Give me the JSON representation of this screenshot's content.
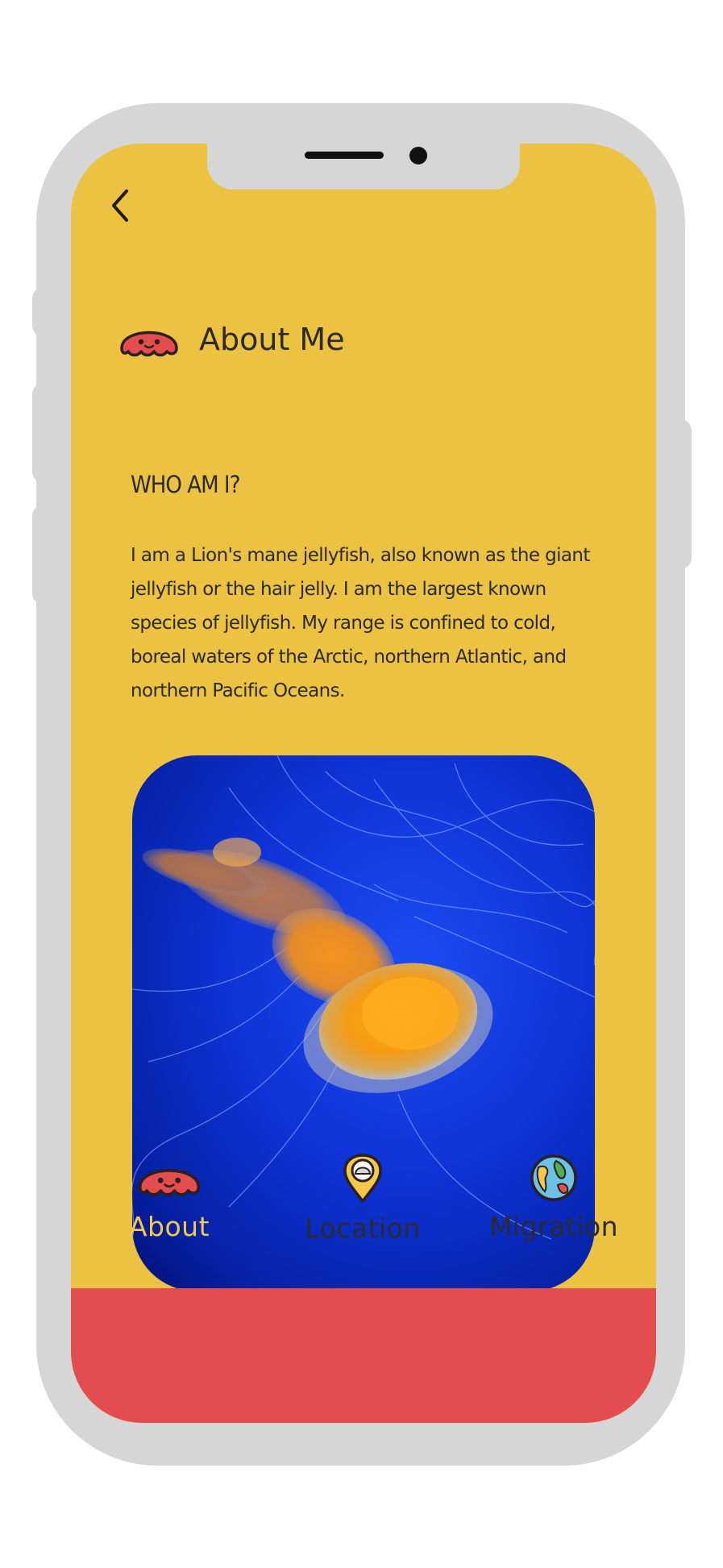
{
  "colors": {
    "screen_bg": "#ecc243",
    "tabbar_bg": "#e44d4d",
    "active_tab": "#f2c94c",
    "inactive_tab": "#2d2a2e",
    "frame": "#d6d6d6"
  },
  "header": {
    "back_icon": "chevron-left-icon",
    "logo_icon": "jellyfish-icon",
    "title": "About Me"
  },
  "content": {
    "heading": "WHO AM I?",
    "body": "I am a Lion's mane jellyfish, also known as the giant jellyfish or the hair jelly. I am the largest known species of jellyfish. My range is confined to cold, boreal waters of the Arctic, northern Atlantic, and northern Pacific Oceans."
  },
  "tabs": [
    {
      "label": "About",
      "icon": "jellyfish-icon",
      "active": true
    },
    {
      "label": "Location",
      "icon": "location-pin-icon",
      "active": false
    },
    {
      "label": "Migration",
      "icon": "globe-icon",
      "active": false
    }
  ]
}
